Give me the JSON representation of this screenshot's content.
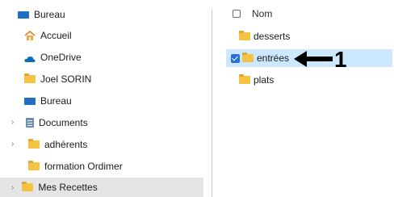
{
  "nav": {
    "items": [
      {
        "label": "Bureau"
      },
      {
        "label": "Accueil"
      },
      {
        "label": "OneDrive"
      },
      {
        "label": "Joel SORIN"
      },
      {
        "label": "Bureau"
      },
      {
        "label": "Documents"
      },
      {
        "label": "adhérents"
      },
      {
        "label": "formation Ordimer"
      },
      {
        "label": "Mes Recettes"
      }
    ]
  },
  "content": {
    "header_label": "Nom",
    "files": [
      {
        "name": "desserts"
      },
      {
        "name": "entrées"
      },
      {
        "name": "plats"
      }
    ]
  },
  "annotation": {
    "number": "1"
  },
  "colors": {
    "selection": "#cce8ff",
    "nav_selection": "#e5e5e5",
    "folder": "#f5c242",
    "accent": "#2b6fd6"
  }
}
